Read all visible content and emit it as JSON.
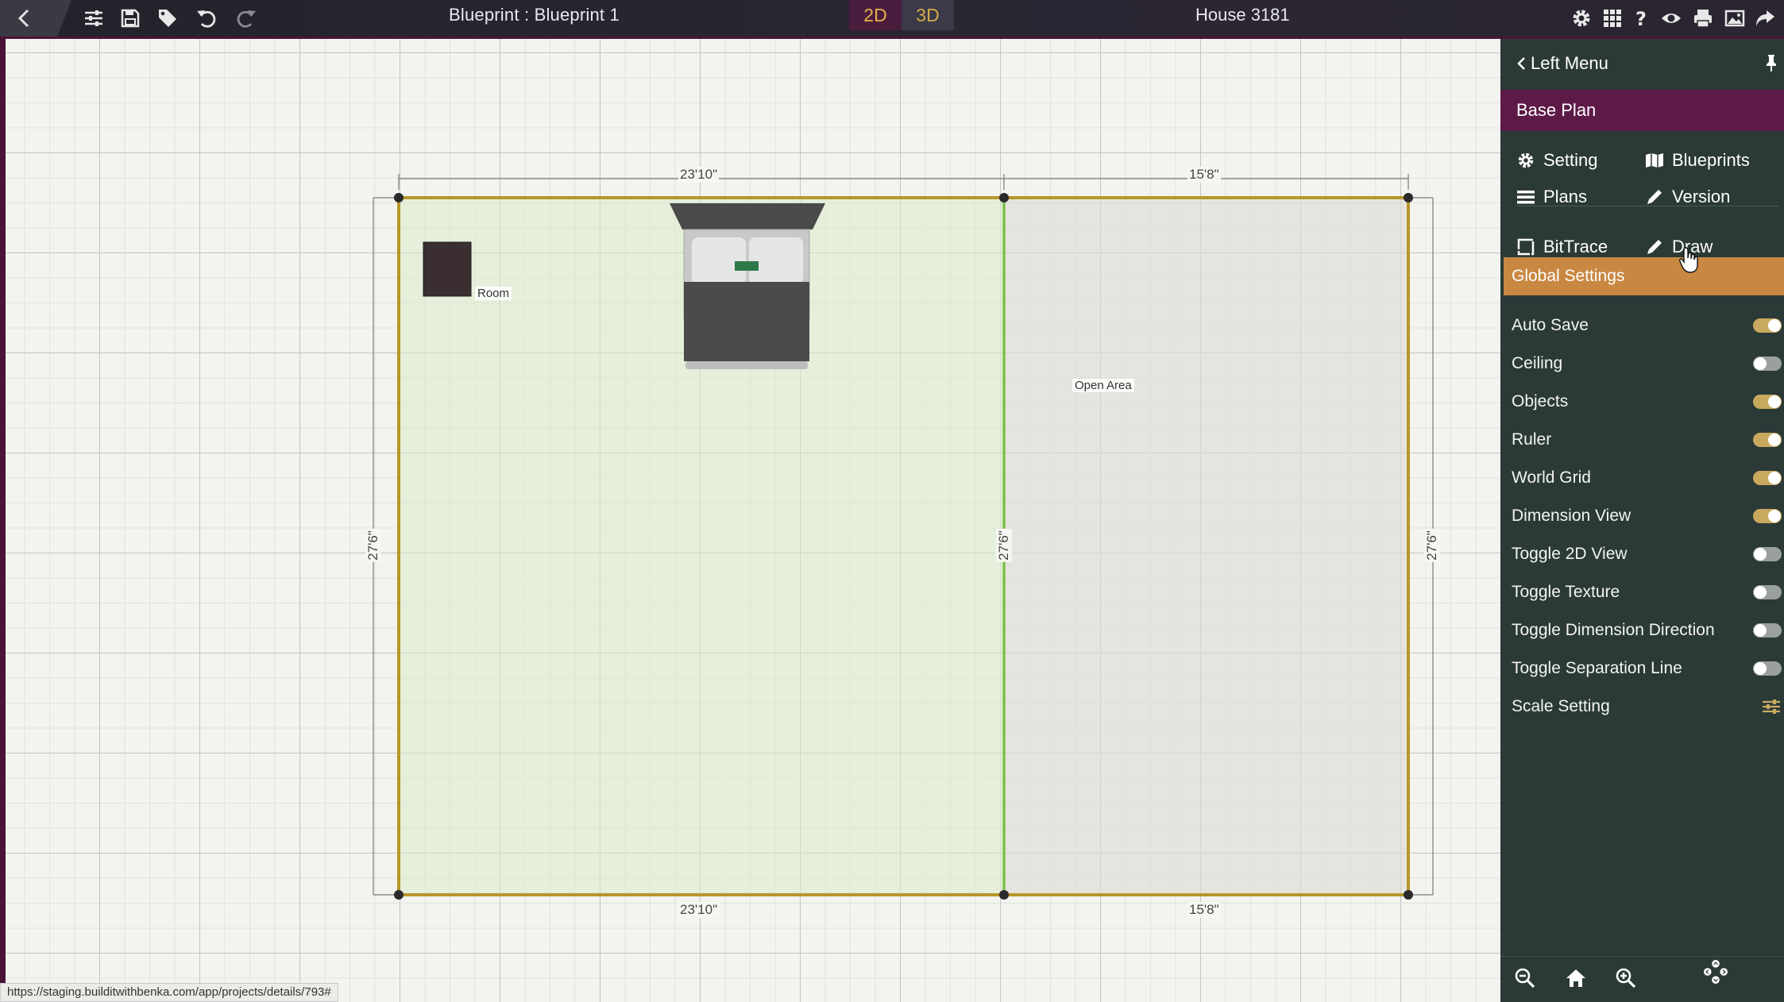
{
  "topbar": {
    "blueprint_title": "Blueprint : Blueprint 1",
    "view_2d": "2D",
    "view_3d": "3D",
    "house_title": "House 3181",
    "left_icons": [
      "back-icon",
      "sliders-icon",
      "save-icon",
      "tag-icon",
      "undo-icon",
      "redo-icon"
    ],
    "right_icons": [
      "gear-icon",
      "grid-icon",
      "help-icon",
      "eye-icon",
      "print-icon",
      "image-icon",
      "share-icon"
    ]
  },
  "canvas": {
    "dimensions": {
      "top_left": "23'10\"",
      "top_right": "15'8\"",
      "bottom_left": "23'10\"",
      "bottom_right": "15'8\"",
      "left": "27'6\"",
      "middle": "27'6\"",
      "right": "27'6\""
    },
    "labels": {
      "room": "Room",
      "open_area": "Open Area"
    }
  },
  "panel": {
    "left_menu": "Left Menu",
    "base_plan": "Base Plan",
    "menu": {
      "setting": "Setting",
      "blueprints": "Blueprints",
      "plans": "Plans",
      "version": "Version",
      "bittrace": "BitTrace",
      "draw": "Draw"
    },
    "global_settings": "Global Settings",
    "settings": [
      {
        "label": "Auto Save",
        "on": true
      },
      {
        "label": "Ceiling",
        "on": false
      },
      {
        "label": "Objects",
        "on": true
      },
      {
        "label": "Ruler",
        "on": true
      },
      {
        "label": "World Grid",
        "on": true
      },
      {
        "label": "Dimension View",
        "on": true
      },
      {
        "label": "Toggle 2D View",
        "on": false
      },
      {
        "label": "Toggle Texture",
        "on": false
      },
      {
        "label": "Toggle Dimension Direction",
        "on": false
      },
      {
        "label": "Toggle Separation Line",
        "on": false
      }
    ],
    "scale_setting": "Scale Setting"
  },
  "status_url": "https://staging.builditwithbenka.com/app/projects/details/793#",
  "colors": {
    "accent_maroon": "#5e1a47",
    "global_orange": "#c98842",
    "panel_bg": "#2b3a37",
    "wall_gold": "#b8962a",
    "divider_green": "#7cc04a"
  }
}
